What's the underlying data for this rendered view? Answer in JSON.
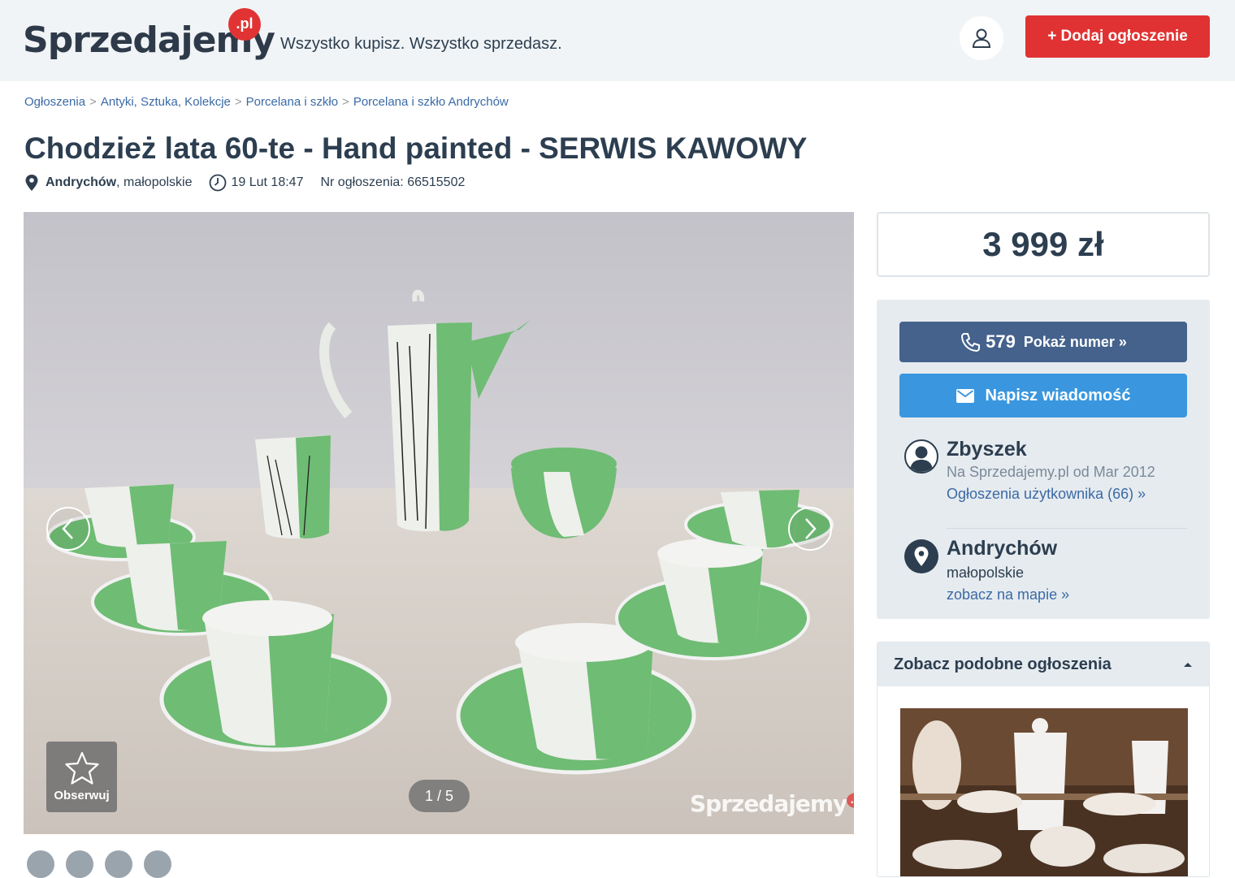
{
  "header": {
    "logo_text": "Sprzedajemy",
    "logo_badge": ".pl",
    "tagline": "Wszystko kupisz. Wszystko sprzedasz.",
    "add_button": "+ Dodaj ogłoszenie"
  },
  "breadcrumb": [
    "Ogłoszenia",
    "Antyki, Sztuka, Kolekcje",
    "Porcelana i szkło",
    "Porcelana i szkło Andrychów"
  ],
  "breadcrumb_sep": ">",
  "listing": {
    "title": "Chodzież lata 60-te - Hand painted - SERWIS KAWOWY",
    "city": "Andrychów",
    "region_suffix": ", małopolskie",
    "date": "19 Lut 18:47",
    "number": "Nr ogłoszenia: 66515502"
  },
  "gallery": {
    "counter": "1 / 5",
    "follow_label": "Obserwuj",
    "watermark": "Sprzedajemy",
    "watermark_badge": ".pl"
  },
  "price": "3 999 zł",
  "contact": {
    "phone_prefix": "579",
    "phone_label": "Pokaż numer »",
    "message_label": "Napisz wiadomość"
  },
  "seller": {
    "name": "Zbyszek",
    "since": "Na Sprzedajemy.pl od Mar 2012",
    "ads_link": "Ogłoszenia użytkownika (66) »"
  },
  "location": {
    "city": "Andrychów",
    "region": "małopolskie",
    "map_link": "zobacz na mapie »"
  },
  "similar": {
    "title": "Zobacz podobne ogłoszenia"
  },
  "colors": {
    "accent_red": "#e03232",
    "phone_blue": "#44628c",
    "message_blue": "#3a97df",
    "link_blue": "#3b6aa6"
  }
}
